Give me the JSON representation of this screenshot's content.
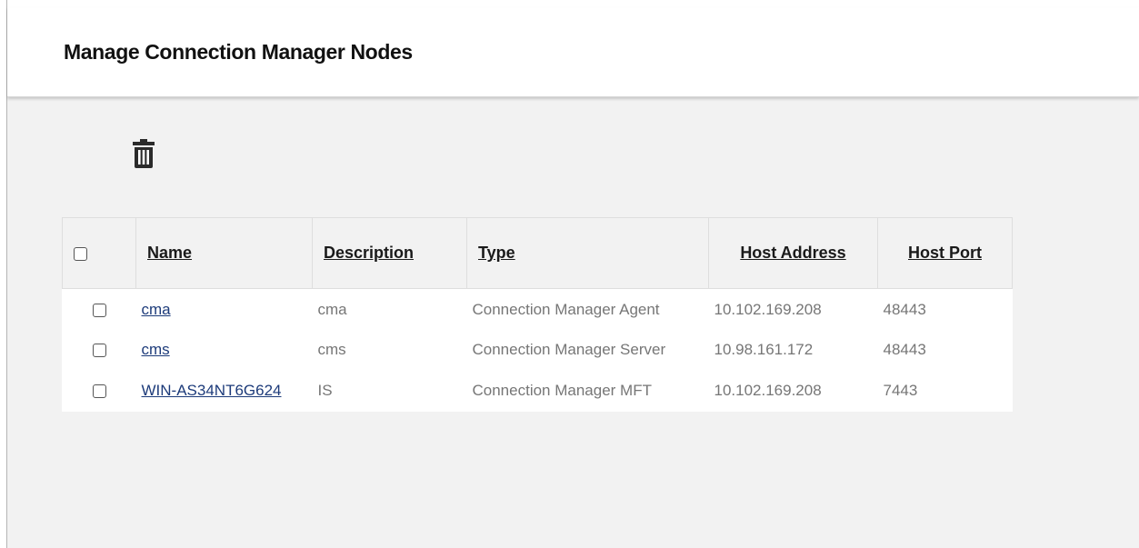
{
  "page": {
    "title": "Manage Connection Manager Nodes"
  },
  "toolbar": {
    "delete_icon": "trash-icon"
  },
  "table": {
    "columns": [
      {
        "key": "select",
        "label": ""
      },
      {
        "key": "name",
        "label": "Name"
      },
      {
        "key": "description",
        "label": "Description"
      },
      {
        "key": "type",
        "label": "Type"
      },
      {
        "key": "host_address",
        "label": "Host Address"
      },
      {
        "key": "host_port",
        "label": "Host Port"
      }
    ],
    "rows": [
      {
        "checked": false,
        "name": "cma",
        "description": "cma",
        "type": "Connection Manager Agent",
        "host_address": "10.102.169.208",
        "host_port": "48443"
      },
      {
        "checked": false,
        "name": "cms",
        "description": "cms",
        "type": "Connection Manager Server",
        "host_address": "10.98.161.172",
        "host_port": "48443"
      },
      {
        "checked": false,
        "name": "WIN-AS34NT6G624",
        "description": "IS",
        "type": "Connection Manager MFT",
        "host_address": "10.102.169.208",
        "host_port": "7443"
      }
    ]
  },
  "colors": {
    "link": "#1d3b7a",
    "cell_text": "#767676",
    "header_bg": "#f2f2f2",
    "page_bg": "#f2f2f2"
  }
}
